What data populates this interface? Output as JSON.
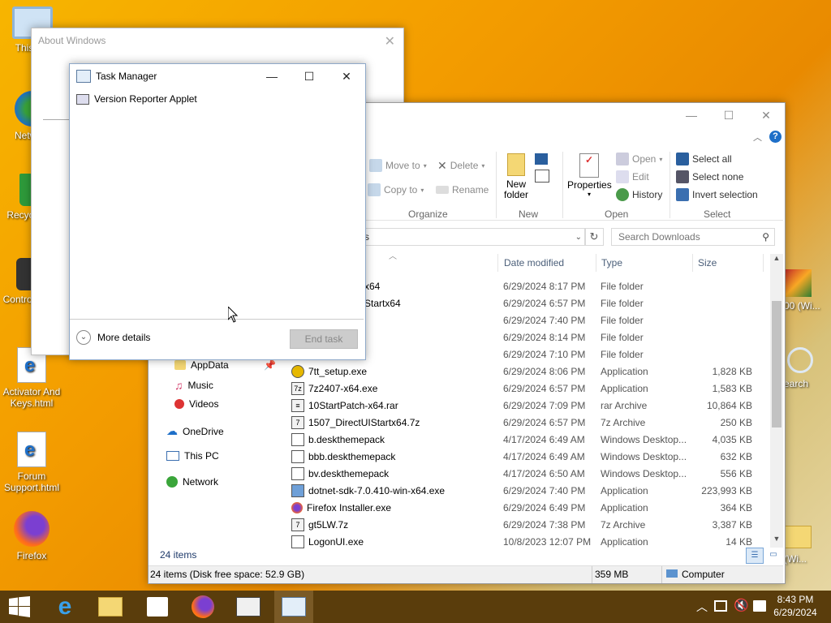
{
  "desktop": {
    "icons": [
      {
        "label": "This PC",
        "icon": "this-pc-icon"
      },
      {
        "label": "Network",
        "icon": "network-icon"
      },
      {
        "label": "Recycle Bin",
        "icon": "recycle-bin-icon"
      },
      {
        "label": "Control Panel",
        "icon": "control-panel-icon"
      },
      {
        "label": "Activator And Keys.html",
        "icon": "html-file-icon"
      },
      {
        "label": "Forum Support.html",
        "icon": "html-file-icon"
      },
      {
        "label": "Firefox",
        "icon": "firefox-icon"
      }
    ],
    "right_icons": [
      {
        "label": "00 (Wi..."
      },
      {
        "label": "earch"
      },
      {
        "label": "(Wi..."
      }
    ]
  },
  "about_window": {
    "title": "About Windows"
  },
  "task_manager": {
    "title": "Task Manager",
    "process": "Version Reporter Applet",
    "more_details": "More details",
    "end_task": "End task"
  },
  "explorer": {
    "ribbon": {
      "organize": {
        "label": "Organize",
        "move_to": "Move to",
        "copy_to": "Copy to",
        "delete": "Delete",
        "rename": "Rename"
      },
      "new": {
        "label": "New",
        "new_folder_1": "New",
        "new_folder_2": "folder"
      },
      "open": {
        "label": "Open",
        "properties": "Properties",
        "open": "Open",
        "edit": "Edit",
        "history": "History"
      },
      "select": {
        "label": "Select",
        "select_all": "Select all",
        "select_none": "Select none",
        "invert": "Invert selection"
      }
    },
    "address_fragment": "s",
    "search_placeholder": "Search Downloads",
    "columns": {
      "date": "Date modified",
      "type": "Type",
      "size": "Size"
    },
    "nav": [
      {
        "label": "AppData"
      },
      {
        "label": "Music"
      },
      {
        "label": "Videos"
      },
      {
        "label": "OneDrive"
      },
      {
        "label": "This PC"
      },
      {
        "label": "Network"
      }
    ],
    "files": [
      {
        "name": "x64",
        "date": "6/29/2024 8:17 PM",
        "type": "File folder",
        "size": ""
      },
      {
        "name": "Startx64",
        "date": "6/29/2024 6:57 PM",
        "type": "File folder",
        "size": ""
      },
      {
        "name": "",
        "date": "6/29/2024 7:40 PM",
        "type": "File folder",
        "size": ""
      },
      {
        "name": "",
        "date": "6/29/2024 8:14 PM",
        "type": "File folder",
        "size": ""
      },
      {
        "name": "",
        "date": "6/29/2024 7:10 PM",
        "type": "File folder",
        "size": ""
      },
      {
        "name": "7tt_setup.exe",
        "date": "6/29/2024 8:06 PM",
        "type": "Application",
        "size": "1,828 KB"
      },
      {
        "name": "7z2407-x64.exe",
        "date": "6/29/2024 6:57 PM",
        "type": "Application",
        "size": "1,583 KB"
      },
      {
        "name": "10StartPatch-x64.rar",
        "date": "6/29/2024 7:09 PM",
        "type": "rar Archive",
        "size": "10,864 KB"
      },
      {
        "name": "1507_DirectUIStartx64.7z",
        "date": "6/29/2024 6:57 PM",
        "type": "7z Archive",
        "size": "250 KB"
      },
      {
        "name": "b.deskthemepack",
        "date": "4/17/2024 6:49 AM",
        "type": "Windows Desktop...",
        "size": "4,035 KB"
      },
      {
        "name": "bbb.deskthemepack",
        "date": "4/17/2024 6:49 AM",
        "type": "Windows Desktop...",
        "size": "632 KB"
      },
      {
        "name": "bv.deskthemepack",
        "date": "4/17/2024 6:50 AM",
        "type": "Windows Desktop...",
        "size": "556 KB"
      },
      {
        "name": "dotnet-sdk-7.0.410-win-x64.exe",
        "date": "6/29/2024 7:40 PM",
        "type": "Application",
        "size": "223,993 KB"
      },
      {
        "name": "Firefox Installer.exe",
        "date": "6/29/2024 6:49 PM",
        "type": "Application",
        "size": "364 KB"
      },
      {
        "name": "gt5LW.7z",
        "date": "6/29/2024 7:38 PM",
        "type": "7z Archive",
        "size": "3,387 KB"
      },
      {
        "name": "LogonUI.exe",
        "date": "10/8/2023 12:07 PM",
        "type": "Application",
        "size": "14 KB"
      }
    ],
    "item_count": "24 items",
    "status": {
      "disk": "24 items (Disk free space: 52.9 GB)",
      "size": "359 MB",
      "location": "Computer"
    }
  },
  "taskbar": {
    "time": "8:43 PM",
    "date": "6/29/2024"
  },
  "colors": {
    "accent": "#1e6fc8",
    "taskbar": "#5a3d0c"
  }
}
